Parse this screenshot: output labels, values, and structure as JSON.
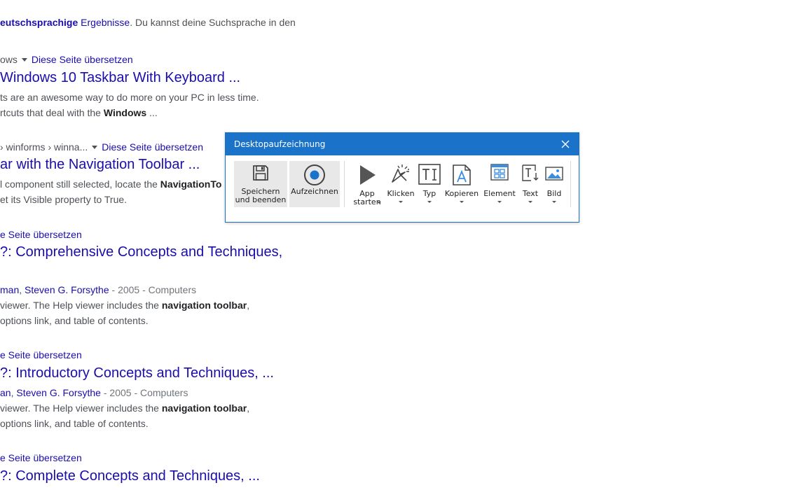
{
  "background": {
    "lang_notice": {
      "bold": "eutschsprachige",
      "link": "Ergebnisse",
      "rest": ". Du kannst deine Suchsprache in den"
    },
    "results": [
      {
        "crumb": "ows",
        "translate": "Diese Seite übersetzen",
        "title": "Windows 10 Taskbar With Keyboard ...",
        "snippet1": "ts are an awesome way to do more on your PC in less time.",
        "snippet2_pre": "rtcuts that deal with the ",
        "snippet2_bold": "Windows",
        "snippet2_post": " ..."
      },
      {
        "crumb": "› winforms › winna...",
        "translate": "Diese Seite übersetzen",
        "title": "ar with the Navigation Toolbar ...",
        "snippet1_pre": "l component still selected, locate the ",
        "snippet1_bold": "NavigationTo",
        "snippet2": "et its Visible property to True."
      },
      {
        "translate": "e Seite übersetzen",
        "title": "?: Comprehensive Concepts and Techniques,",
        "authors": [
          "man",
          "Steven G. Forsythe"
        ],
        "meta": " - 2005 - Computers",
        "snippet1_pre": "viewer. The Help viewer includes the ",
        "snippet1_bold": "navigation toolbar",
        "snippet1_post": ",",
        "snippet2": "options link, and table of contents."
      },
      {
        "translate": "e Seite übersetzen",
        "title": "?: Introductory Concepts and Techniques, ...",
        "authors": [
          "an",
          "Steven G. Forsythe"
        ],
        "meta": " - 2005 - Computers",
        "snippet1_pre": "viewer. The Help viewer includes the ",
        "snippet1_bold": "navigation toolbar",
        "snippet1_post": ",",
        "snippet2": "options link, and table of contents."
      },
      {
        "translate": "e Seite übersetzen",
        "title": "?: Complete Concepts and Techniques, ..."
      }
    ]
  },
  "dialog": {
    "title": "Desktopaufzeichnung",
    "tools": {
      "save": [
        "Speichern",
        "und beenden"
      ],
      "record": "Aufzeichnen",
      "app": [
        "App",
        "starten"
      ],
      "click": "Klicken",
      "type": "Typ",
      "copy": "Kopieren",
      "element": "Element",
      "text": "Text",
      "image": "Bild"
    }
  },
  "colors": {
    "accent": "#1a73c9",
    "link": "#1a0dab",
    "record": "#1a73c9"
  }
}
